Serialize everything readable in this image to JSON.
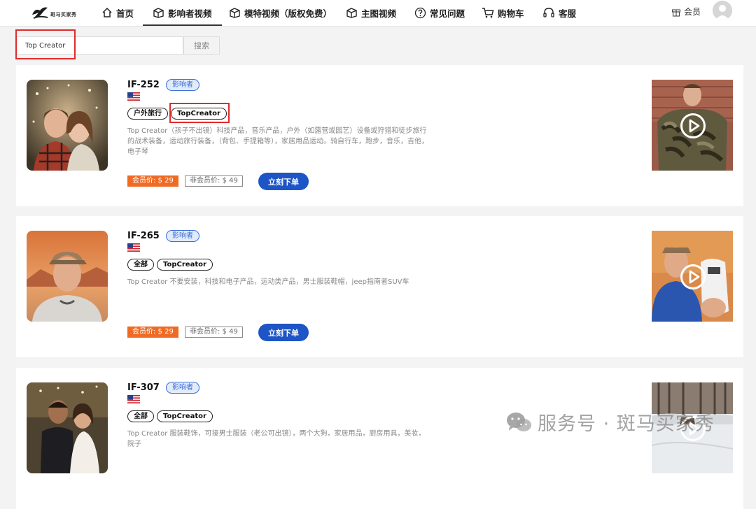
{
  "nav": {
    "logo_text": "斑马买家秀",
    "items": [
      {
        "label": "首页",
        "icon": "home-icon"
      },
      {
        "label": "影响者视频",
        "icon": "box-icon"
      },
      {
        "label": "模特视频（版权免费）",
        "icon": "box-icon"
      },
      {
        "label": "主图视频",
        "icon": "box-icon"
      },
      {
        "label": "常见问题",
        "icon": "question-icon"
      },
      {
        "label": "购物车",
        "icon": "cart-icon"
      },
      {
        "label": "客服",
        "icon": "headset-icon"
      }
    ],
    "active_index": 1,
    "member_label": "会员"
  },
  "search": {
    "value": "Top Creator",
    "button_label": "搜索"
  },
  "cards": [
    {
      "id": "IF-252",
      "badge": "影响者",
      "tags": [
        "户外旅行",
        "TopCreator"
      ],
      "description": "Top Creator（孩子不出镜）科技产品，音乐产品，户外（如露营或园艺）设备或狩猎和徒步旅行的战术装备，运动旅行装备，（背包、手提箱等），家居用品运动。骑自行车，跑步，音乐，吉他，电子琴",
      "member_price": "会员价: $ 29",
      "nonmember_price": "非会员价: $ 49",
      "order_label": "立刻下单"
    },
    {
      "id": "IF-265",
      "badge": "影响者",
      "tags": [
        "全部",
        "TopCreator"
      ],
      "description": "Top Creator 不要安装，科技和电子产品，运动类产品，男士服装鞋帽，jeep指南者SUV车",
      "member_price": "会员价: $ 29",
      "nonmember_price": "非会员价: $ 49",
      "order_label": "立刻下单"
    },
    {
      "id": "IF-307",
      "badge": "影响者",
      "tags": [
        "全部",
        "TopCreator"
      ],
      "description": "Top Creator 服装鞋饰，可接男士服装（老公可出镜），两个大狗，家居用品，厨房用具，美妆，院子",
      "member_price": "",
      "nonmember_price": "",
      "order_label": ""
    }
  ],
  "watermark": "服务号 · 斑马买家秀",
  "colors": {
    "accent_blue": "#1d55c7",
    "price_orange": "#ef6b24",
    "highlight_red": "#e02b2b",
    "badge_blue": "#3a6fd8"
  }
}
